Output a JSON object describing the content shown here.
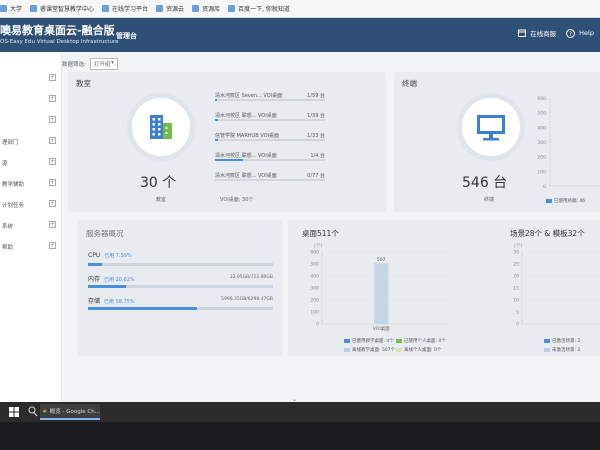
{
  "browser": {
    "bookmarks": [
      {
        "label": "大学"
      },
      {
        "label": "睿课堂智慧教学中心"
      },
      {
        "label": "在线学习平台"
      },
      {
        "label": "资源云"
      },
      {
        "label": "资源库"
      },
      {
        "label": "百度一下, 你就知道"
      }
    ]
  },
  "header": {
    "title": "噢易教育桌面云-融合版",
    "subtitle": "OS-Easy Edu Virtual Desktop Infrastructure",
    "console": "管理台",
    "online_help": "在线商服",
    "help": "Help"
  },
  "sidebar": {
    "items": [
      {
        "label": "",
        "expand": "+"
      },
      {
        "label": "",
        "expand": "+"
      },
      {
        "label": "",
        "expand": "+"
      },
      {
        "label": "理部门",
        "expand": "+"
      },
      {
        "label": "源",
        "expand": "+"
      },
      {
        "label": "教学辅助",
        "expand": "+"
      },
      {
        "label": "计划任务",
        "expand": "+"
      },
      {
        "label": "系统",
        "expand": "+"
      },
      {
        "label": "帮助",
        "expand": "+"
      }
    ]
  },
  "filter": {
    "label": "数据筛选:",
    "value": "打开组"
  },
  "classroom": {
    "title": "教室",
    "count": "30 个",
    "caption": "教室",
    "rooms": [
      {
        "name": "清水河校区 Seven...",
        "type": "VOI桌面",
        "count": "1/59 台",
        "ratio": 0.02
      },
      {
        "name": "清水河校区 联想...",
        "type": "VOI桌面",
        "count": "1/39 台",
        "ratio": 0.03
      },
      {
        "name": "信管学院 MARHUB",
        "type": "VOI桌面",
        "count": "1/33 台",
        "ratio": 0.03
      },
      {
        "name": "清水河校区 联想...",
        "type": "VOI桌面",
        "count": "1/4 台",
        "ratio": 0.25
      },
      {
        "name": "清水河校区 联想...",
        "type": "VOI桌面",
        "count": "0/77 台",
        "ratio": 0
      }
    ],
    "footer": "VOI桌面: 30个"
  },
  "terminal": {
    "title": "终端",
    "count": "546 台",
    "caption": "终端",
    "y_ticks": [
      "600",
      "500",
      "400",
      "300",
      "200",
      "100",
      "0"
    ],
    "legend": "已使用终端: 46"
  },
  "server": {
    "title": "服务器概况",
    "rows": [
      {
        "label": "CPU",
        "usage": "已用 7.59%",
        "right": "",
        "ratio": 0.076
      },
      {
        "label": "内存",
        "usage": "已用 20.62%",
        "right": "32.95GB/722.80GB",
        "ratio": 0.206
      },
      {
        "label": "存储",
        "usage": "已用 58.75%",
        "right": "5996.35GB/6298.47GB",
        "ratio": 0.5875
      }
    ]
  },
  "desktop": {
    "title": "桌面511个",
    "chart_data": {
      "type": "bar",
      "unit": "(个)",
      "categories": [
        "VOI桌面"
      ],
      "values": [
        507
      ],
      "ylim": [
        0,
        600
      ],
      "y_ticks": [
        "600",
        "500",
        "400",
        "300",
        "200",
        "100",
        "0"
      ],
      "legend": [
        {
          "name": "已使用教学桌面: 4个",
          "color": "#4a90d9"
        },
        {
          "name": "已使用个人桌面: 0个",
          "color": "#6cc04a"
        },
        {
          "name": "离线教学桌面: 507个",
          "color": "#b9cde2"
        },
        {
          "name": "离线个人桌面: 0个",
          "color": "#cfe6b8"
        }
      ]
    }
  },
  "scenes": {
    "title": "场景28个 & 模板32个",
    "y_unit": "(个)",
    "y_ticks": [
      "30",
      "25",
      "20",
      "15",
      "10",
      "5",
      "0"
    ],
    "legend": [
      {
        "name": "已激活场景: 2",
        "color": "#4a90d9"
      },
      {
        "name": "未激活场景: 2",
        "color": "#b9cde2"
      }
    ]
  },
  "taskbar": {
    "app_label": "概览 - Google Ch..."
  }
}
